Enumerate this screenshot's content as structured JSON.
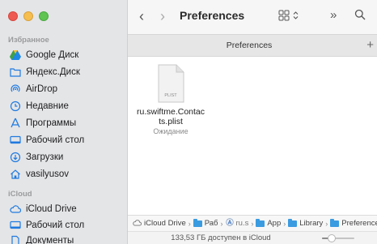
{
  "sidebar": {
    "favorites_header": "Избранное",
    "favorites": [
      {
        "label": "Google Диск",
        "icon": "google-drive-icon"
      },
      {
        "label": "Яндекс.Диск",
        "icon": "folder-icon"
      },
      {
        "label": "AirDrop",
        "icon": "airdrop-icon"
      },
      {
        "label": "Недавние",
        "icon": "clock-icon"
      },
      {
        "label": "Программы",
        "icon": "apps-icon"
      },
      {
        "label": "Рабочий стол",
        "icon": "desktop-icon"
      },
      {
        "label": "Загрузки",
        "icon": "download-icon"
      },
      {
        "label": "vasilyusov",
        "icon": "home-icon"
      }
    ],
    "icloud_header": "iCloud",
    "icloud": [
      {
        "label": "iCloud Drive",
        "icon": "cloud-icon"
      },
      {
        "label": "Рабочий стол",
        "icon": "desktop-icon"
      },
      {
        "label": "Документы",
        "icon": "document-icon"
      }
    ]
  },
  "toolbar": {
    "back": "‹",
    "forward": "›",
    "title": "Preferences",
    "more": "»"
  },
  "tab": {
    "label": "Preferences",
    "add": "+"
  },
  "file": {
    "icon_label": "PLIST",
    "name_line1": "ru.swiftme.Contac",
    "name_line2": "ts.plist",
    "status": "Ожидание"
  },
  "path": [
    {
      "label": "iCloud Drive",
      "kind": "cloud"
    },
    {
      "label": "Раб",
      "kind": "folder"
    },
    {
      "label": "ru.s",
      "kind": "app"
    },
    {
      "label": "App",
      "kind": "folder"
    },
    {
      "label": "Library",
      "kind": "folder"
    },
    {
      "label": "Preferences",
      "kind": "folder"
    }
  ],
  "path_separator": "›",
  "status": {
    "text": "133,53 ГБ доступен в iCloud",
    "zoom_level": 0.3
  },
  "colors": {
    "accent": "#1f7ae0",
    "folder": "#3a9be0",
    "sidebar_bg": "#e4e5e7"
  }
}
